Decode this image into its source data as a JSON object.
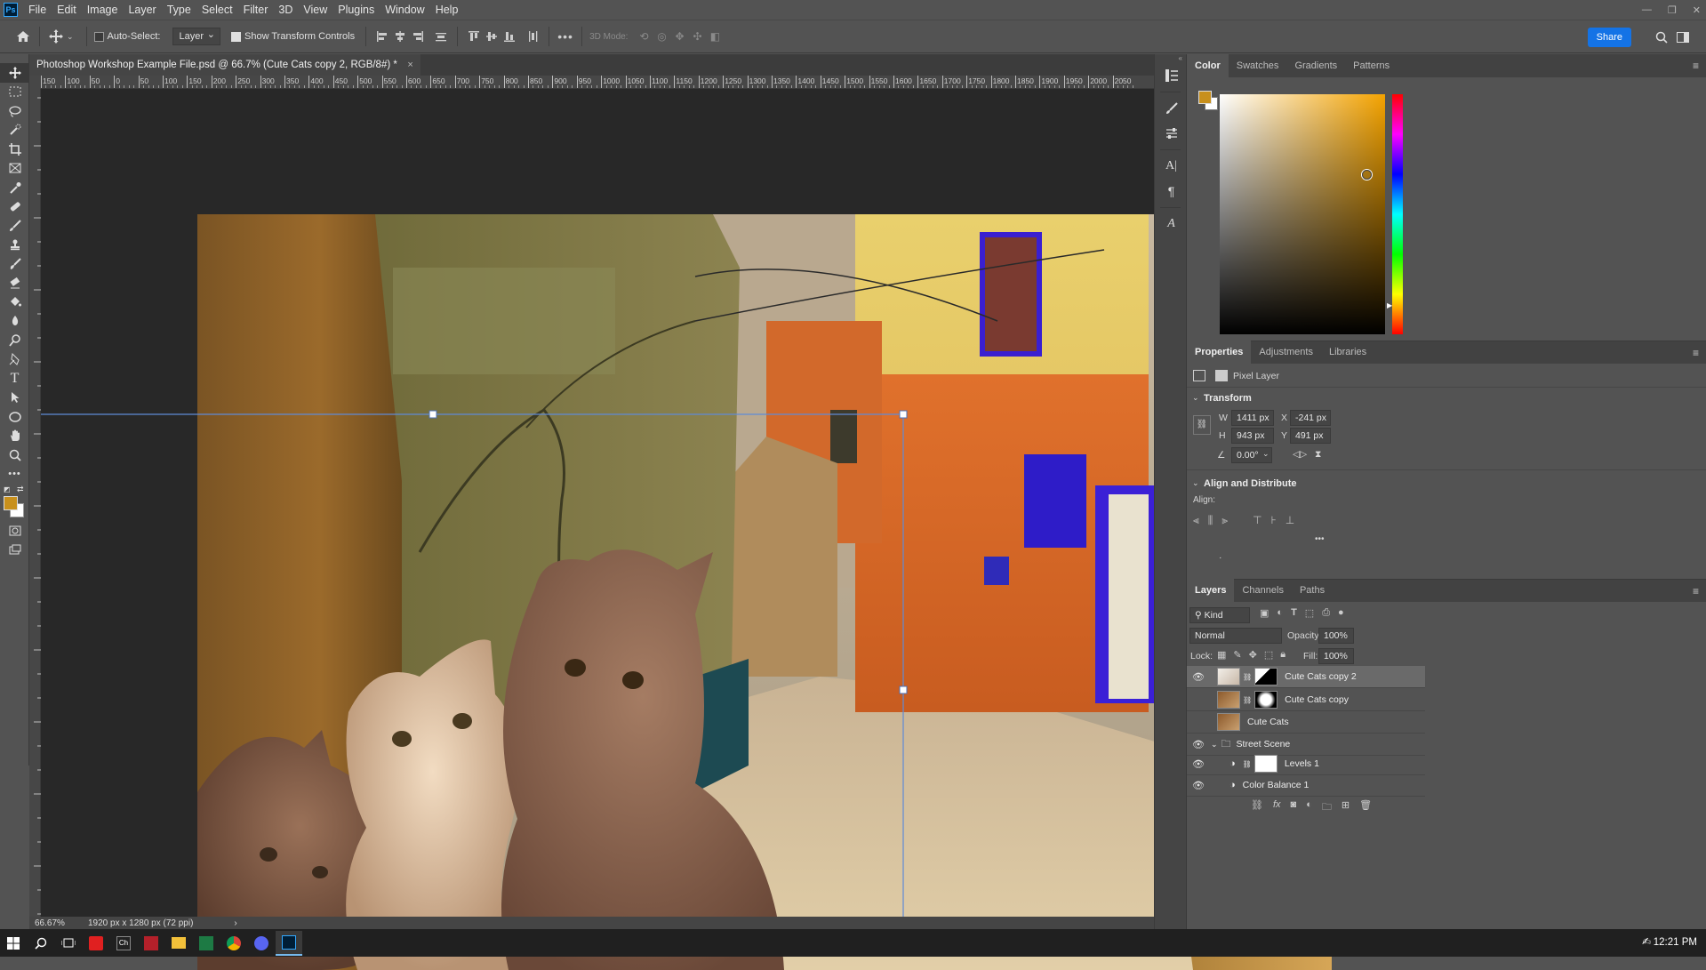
{
  "app": {
    "logo": "Ps",
    "menu": [
      "File",
      "Edit",
      "Image",
      "Layer",
      "Type",
      "Select",
      "Filter",
      "3D",
      "View",
      "Plugins",
      "Window",
      "Help"
    ]
  },
  "options": {
    "auto_select_label": "Auto-Select:",
    "auto_select_target": "Layer",
    "show_transform_label": "Show Transform Controls",
    "three_d_mode_label": "3D Mode:",
    "share_label": "Share"
  },
  "document": {
    "tab_title": "Photoshop Workshop Example File.psd @ 66.7% (Cute Cats copy 2, RGB/8#) *",
    "close_glyph": "×",
    "zoom": "66.67%",
    "doc_info": "1920 px x 1280 px (72 ppi)",
    "status_arrow": "›"
  },
  "ruler": {
    "h_ticks": [
      "150",
      "100",
      "50",
      "0",
      "50",
      "100",
      "150",
      "200",
      "250",
      "300",
      "350",
      "400",
      "450",
      "500",
      "550",
      "600",
      "650",
      "700",
      "750",
      "800",
      "850",
      "900",
      "950",
      "1000",
      "1050",
      "1100",
      "1150",
      "1200",
      "1250",
      "1300",
      "1350",
      "1400",
      "1450",
      "1500",
      "1550",
      "1600",
      "1650",
      "1700",
      "1750",
      "1800",
      "1850",
      "1900",
      "1950",
      "2000",
      "2050"
    ]
  },
  "color_panel": {
    "tabs": [
      "Color",
      "Swatches",
      "Gradients",
      "Patterns"
    ],
    "active_tab": "Color",
    "foreground": "#c8901c",
    "background": "#ffffff",
    "hue_color": "#f4a300"
  },
  "properties": {
    "tabs": [
      "Properties",
      "Adjustments",
      "Libraries"
    ],
    "layer_kind": "Pixel Layer",
    "transform_title": "Transform",
    "w_label": "W",
    "w_value": "1411 px",
    "h_label": "H",
    "h_value": "943 px",
    "x_label": "X",
    "x_value": "-241 px",
    "y_label": "Y",
    "y_value": "491 px",
    "angle_value": "0.00°",
    "align_title": "Align and Distribute",
    "align_label": "Align:",
    "more": "•••",
    "dot": "·"
  },
  "layers_panel": {
    "tabs": [
      "Layers",
      "Channels",
      "Paths"
    ],
    "filter_label": "Kind",
    "blend_mode": "Normal",
    "opacity_label": "Opacity:",
    "opacity_value": "100%",
    "lock_label": "Lock:",
    "fill_label": "Fill:",
    "fill_value": "100%",
    "layers": [
      {
        "name": "Cute Cats copy 2",
        "visible": true,
        "selected": true
      },
      {
        "name": "Cute Cats copy",
        "visible": false,
        "selected": false
      },
      {
        "name": "Cute Cats",
        "visible": false,
        "selected": false
      },
      {
        "name": "Street Scene",
        "visible": true,
        "selected": false
      },
      {
        "name": "Levels 1",
        "visible": true,
        "selected": false
      },
      {
        "name": "Color Balance 1",
        "visible": true,
        "selected": false
      }
    ]
  },
  "taskbar": {
    "clock": "12:21 PM"
  }
}
